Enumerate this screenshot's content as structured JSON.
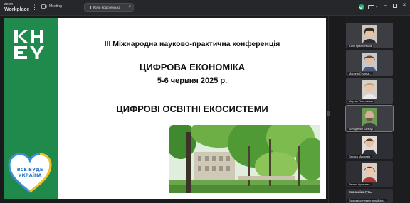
{
  "topbar": {
    "brand_small": "zoom",
    "brand_name": "Workplace",
    "meeting_label": "Meeting",
    "tab_label": "Юлія Краснянська",
    "tab_close": "×",
    "min": "–",
    "close": "✕",
    "chevron": "▾"
  },
  "slide": {
    "conference": "III Міжнародна науково-практична конференція",
    "economy": "ЦИФРОВА ЕКОНОМІКА",
    "dates": "5-6 червня 2025 р.",
    "ecosystems": "ЦИФРОВІ ОСВІТНІ ЕКОСИСТЕМИ",
    "heart_text_1": "ВСЕ БУДЕ",
    "heart_text_2": "УКРАЇНА"
  },
  "participants": [
    {
      "name": "Юлія Краснянська",
      "has_video": true
    },
    {
      "name": "Марина Ступіна...",
      "has_video": true
    },
    {
      "name": "Миргар Плотнікова",
      "has_video": true
    },
    {
      "name": "Володимир Шевчук",
      "has_video": true,
      "selected": true
    },
    {
      "name": "Лариса Миколаїв",
      "has_video": false
    },
    {
      "name": "Тетяна Кучерява",
      "has_video": false
    },
    {
      "name": "Економіко-гуманітарний фа...",
      "label": "Економіко-гум...",
      "has_video": false
    }
  ],
  "colors": {
    "slide_green": "#1f8a4c",
    "accent_green": "#17b26a"
  }
}
